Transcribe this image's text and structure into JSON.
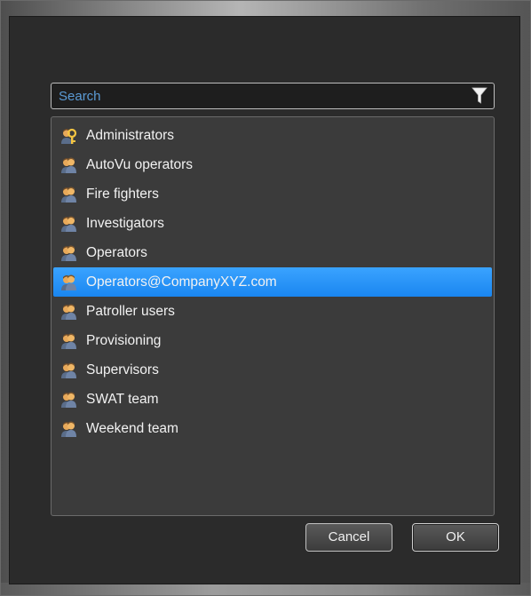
{
  "search": {
    "placeholder": "Search",
    "filter_icon": "filter-funnel-icon"
  },
  "list": {
    "items": [
      {
        "label": "Administrators",
        "icon": "admin-group-icon",
        "selected": false
      },
      {
        "label": "AutoVu operators",
        "icon": "user-group-icon",
        "selected": false
      },
      {
        "label": "Fire fighters",
        "icon": "user-group-icon",
        "selected": false
      },
      {
        "label": "Investigators",
        "icon": "user-group-icon",
        "selected": false
      },
      {
        "label": "Operators",
        "icon": "user-group-icon",
        "selected": false
      },
      {
        "label": "Operators@CompanyXYZ.com",
        "icon": "user-group-icon",
        "selected": true
      },
      {
        "label": "Patroller users",
        "icon": "user-group-icon",
        "selected": false
      },
      {
        "label": "Provisioning",
        "icon": "user-group-icon",
        "selected": false
      },
      {
        "label": "Supervisors",
        "icon": "user-group-icon",
        "selected": false
      },
      {
        "label": "SWAT team",
        "icon": "user-group-icon",
        "selected": false
      },
      {
        "label": "Weekend team",
        "icon": "user-group-icon",
        "selected": false
      }
    ]
  },
  "buttons": {
    "cancel_label": "Cancel",
    "ok_label": "OK"
  },
  "colors": {
    "dialog_bg": "#2b2b2b",
    "list_bg": "#3b3b3b",
    "selection": "#1a86f0",
    "placeholder": "#5b9bd5"
  }
}
